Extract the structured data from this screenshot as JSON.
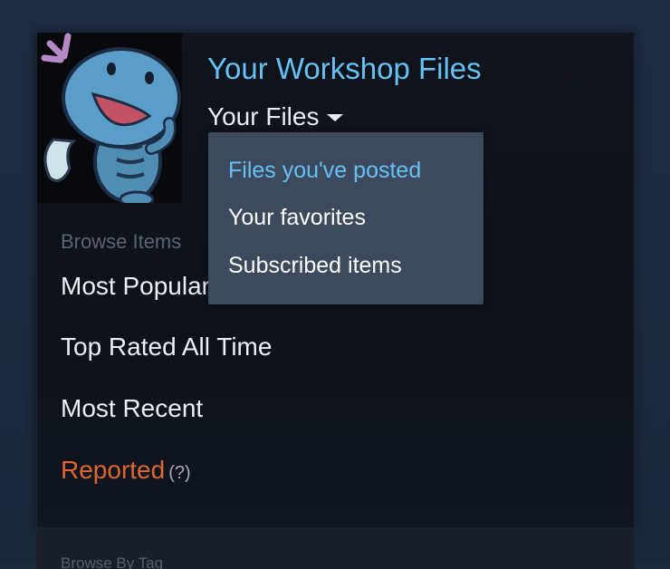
{
  "header": {
    "title": "Your Workshop Files",
    "filter_label": "Your Files"
  },
  "dropdown": {
    "options": [
      {
        "label": "Files you've posted",
        "selected": true
      },
      {
        "label": "Your favorites",
        "selected": false
      },
      {
        "label": "Subscribed items",
        "selected": false
      }
    ]
  },
  "browse": {
    "heading": "Browse Items",
    "items": [
      {
        "label": "Most Popular"
      },
      {
        "label": "Top Rated All Time"
      },
      {
        "label": "Most Recent"
      },
      {
        "label": "Reported",
        "help": "(?)"
      }
    ]
  },
  "next_section": {
    "heading": "Browse By Tag"
  },
  "colors": {
    "accent": "#66c0f4",
    "reported": "#e0652f",
    "dropdown_bg": "#3d4a5d",
    "panel_bg": "#0f141d"
  },
  "avatar": {
    "icon": "blue-cartoon-creature-avatar"
  }
}
